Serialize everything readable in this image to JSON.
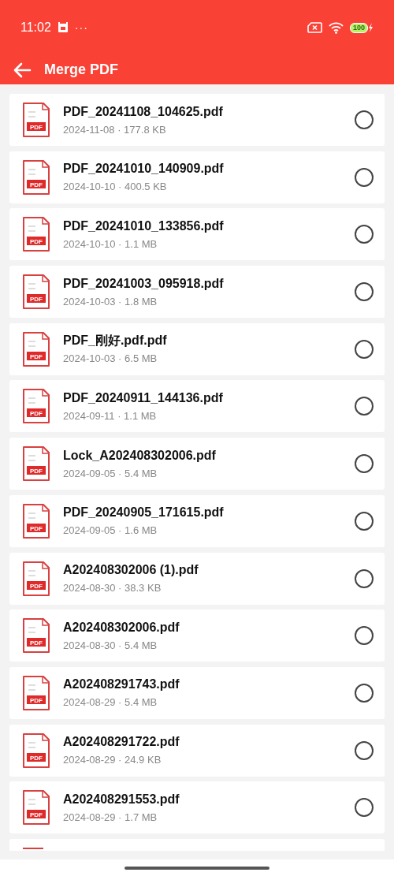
{
  "status_bar": {
    "time": "11:02",
    "more": "···",
    "battery": "100"
  },
  "app_bar": {
    "title": "Merge PDF"
  },
  "files": [
    {
      "name": "PDF_20241108_104625.pdf",
      "meta": "2024-11-08 · 177.8 KB",
      "badge": "PDF",
      "selected": false
    },
    {
      "name": "PDF_20241010_140909.pdf",
      "meta": "2024-10-10 · 400.5 KB",
      "badge": "PDF",
      "selected": false
    },
    {
      "name": "PDF_20241010_133856.pdf",
      "meta": "2024-10-10 · 1.1 MB",
      "badge": "PDF",
      "selected": false
    },
    {
      "name": "PDF_20241003_095918.pdf",
      "meta": "2024-10-03 · 1.8 MB",
      "badge": "PDF",
      "selected": false
    },
    {
      "name": "PDF_刚好.pdf.pdf",
      "meta": "2024-10-03 · 6.5 MB",
      "badge": "PDF",
      "selected": false
    },
    {
      "name": "PDF_20240911_144136.pdf",
      "meta": "2024-09-11 · 1.1 MB",
      "badge": "PDF",
      "selected": false
    },
    {
      "name": "Lock_A202408302006.pdf",
      "meta": "2024-09-05 · 5.4 MB",
      "badge": "PDF",
      "selected": false
    },
    {
      "name": "PDF_20240905_171615.pdf",
      "meta": "2024-09-05 · 1.6 MB",
      "badge": "PDF",
      "selected": false
    },
    {
      "name": "A202408302006 (1).pdf",
      "meta": "2024-08-30 · 38.3 KB",
      "badge": "PDF",
      "selected": false
    },
    {
      "name": "A202408302006.pdf",
      "meta": "2024-08-30 · 5.4 MB",
      "badge": "PDF",
      "selected": false
    },
    {
      "name": "A202408291743.pdf",
      "meta": "2024-08-29 · 5.4 MB",
      "badge": "PDF",
      "selected": false
    },
    {
      "name": "A202408291722.pdf",
      "meta": "2024-08-29 · 24.9 KB",
      "badge": "PDF",
      "selected": false
    },
    {
      "name": "A202408291553.pdf",
      "meta": "2024-08-29 · 1.7 MB",
      "badge": "PDF",
      "selected": false
    }
  ],
  "clipped_item_below": true
}
